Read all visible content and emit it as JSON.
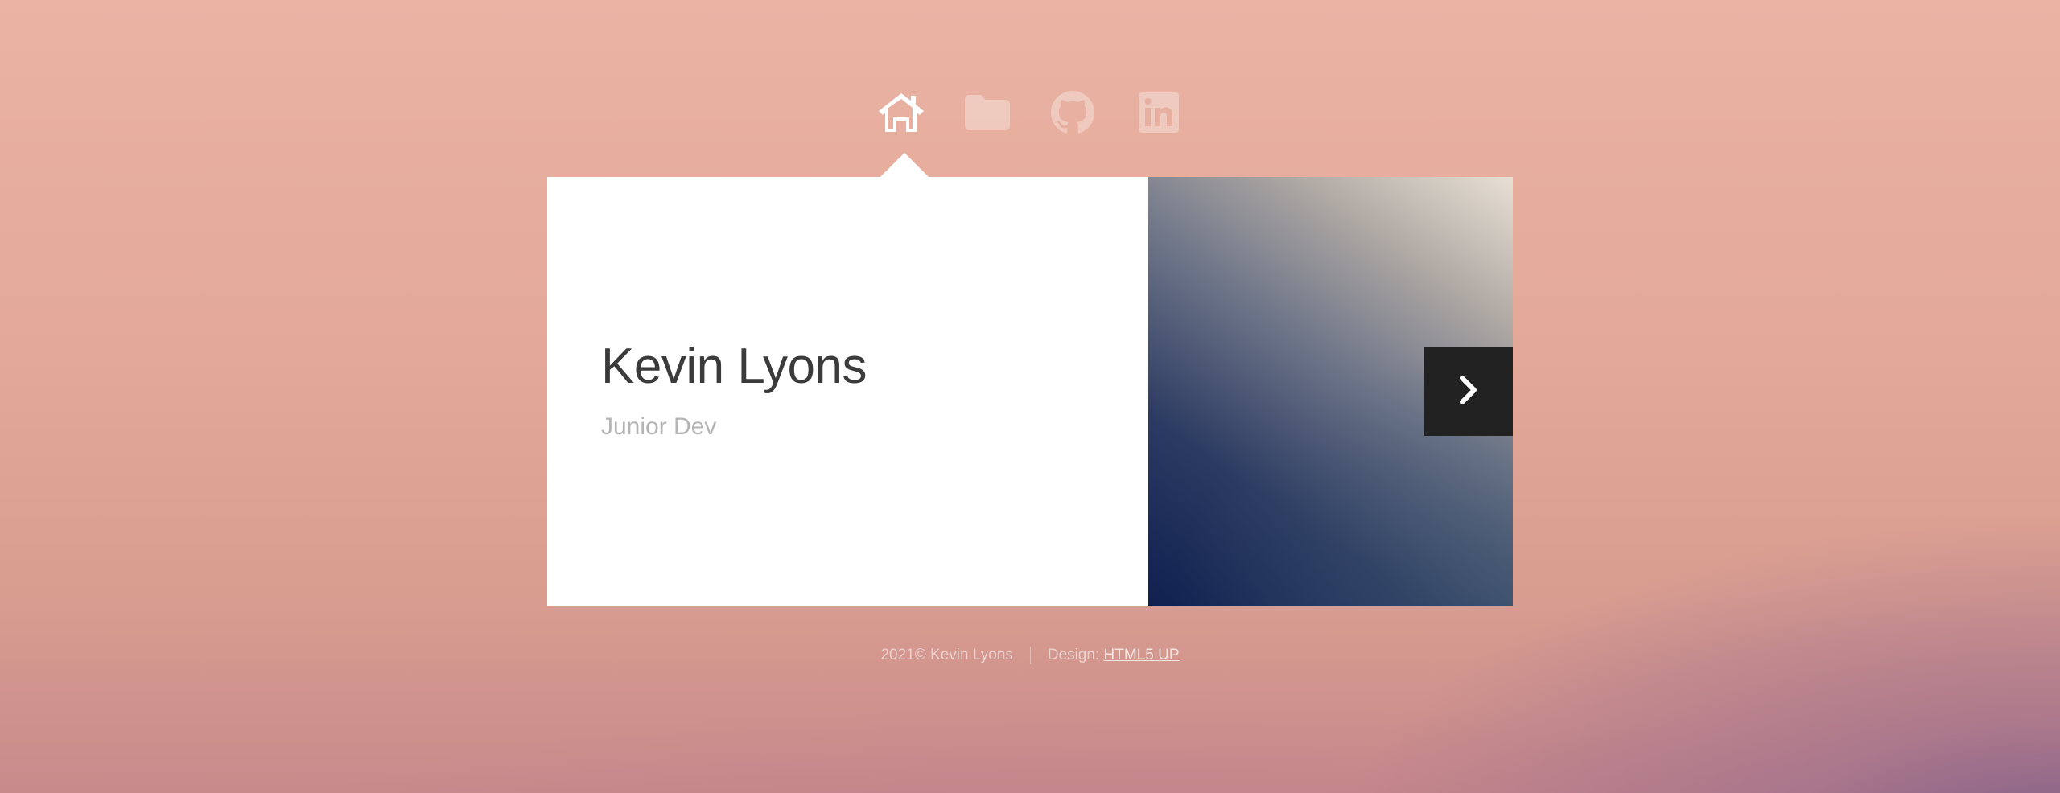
{
  "nav": {
    "items": [
      {
        "icon": "home-icon",
        "active": true
      },
      {
        "icon": "folder-icon",
        "active": false
      },
      {
        "icon": "github-icon",
        "active": false
      },
      {
        "icon": "linkedin-icon",
        "active": false
      }
    ]
  },
  "profile": {
    "name": "Kevin Lyons",
    "role": "Junior Dev"
  },
  "card": {
    "next_icon": "chevron-right-icon"
  },
  "footer": {
    "copyright": "2021© Kevin Lyons",
    "design_label": "Design: ",
    "design_link": "HTML5 UP"
  },
  "colors": {
    "card_bg": "#ffffff",
    "name_text": "#3b3b3b",
    "role_text": "#b4b4b4",
    "next_button_bg": "#222222",
    "nav_active": "#ffffff"
  }
}
